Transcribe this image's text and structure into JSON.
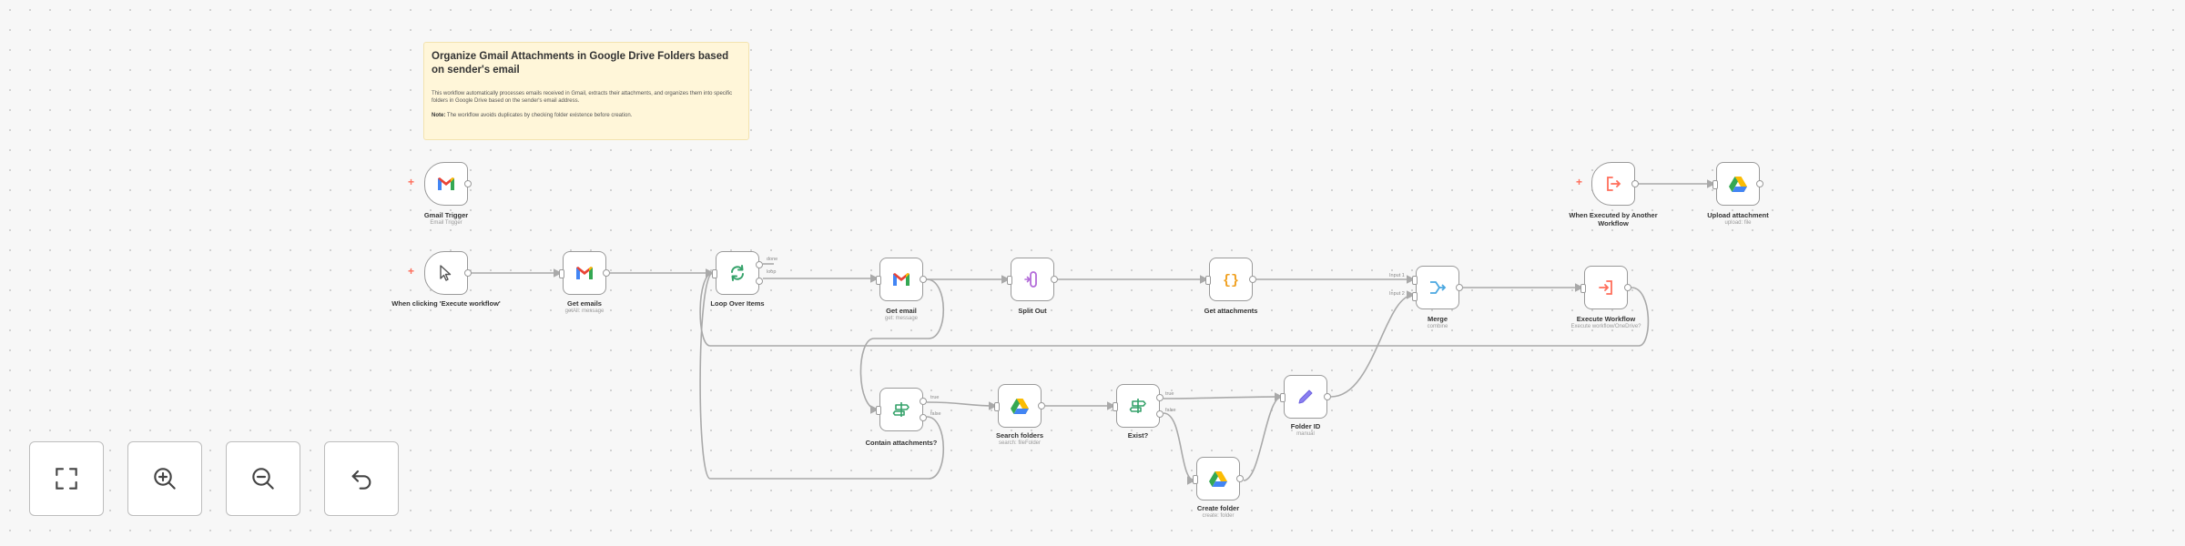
{
  "sticky": {
    "title": "Organize Gmail Attachments in Google Drive Folders based on sender's email",
    "body": "This workflow automatically processes emails received in Gmail, extracts their attachments, and organizes them into specific folders in Google Drive based on the sender's email address.",
    "note_label": "Note:",
    "note_text": "The workflow avoids duplicates by checking folder existence before creation."
  },
  "nodes": {
    "gmail_trigger": {
      "label": "Gmail Trigger",
      "sub": "Email Trigger",
      "icon": "gmail-icon"
    },
    "manual_trigger": {
      "label": "When clicking 'Execute workflow'",
      "icon": "cursor-icon"
    },
    "get_emails": {
      "label": "Get emails",
      "sub": "getAll: message",
      "icon": "gmail-icon"
    },
    "loop": {
      "label": "Loop Over Items",
      "icon": "loop-icon"
    },
    "get_email": {
      "label": "Get email",
      "sub": "get: message",
      "icon": "gmail-icon"
    },
    "split_out": {
      "label": "Split Out",
      "icon": "split-icon"
    },
    "get_attachments": {
      "label": "Get attachments",
      "icon": "code-icon"
    },
    "merge": {
      "label": "Merge",
      "sub": "combine",
      "icon": "merge-icon"
    },
    "execute_workflow": {
      "label": "Execute Workflow",
      "sub": "Execute workflow/OneDrive?",
      "icon": "execute-icon"
    },
    "workflow_trigger": {
      "label": "When Executed by Another Workflow",
      "icon": "workflow-trigger-icon"
    },
    "upload_attachment": {
      "label": "Upload attachment",
      "sub": "upload: file",
      "icon": "google-drive-icon"
    },
    "contain_attachments": {
      "label": "Contain attachments?",
      "icon": "if-icon"
    },
    "search_folders": {
      "label": "Search folders",
      "sub": "search: fileFolder",
      "icon": "google-drive-icon"
    },
    "exist": {
      "label": "Exist?",
      "icon": "if-icon"
    },
    "folder_id": {
      "label": "Folder ID",
      "sub": "manual",
      "icon": "pencil-icon"
    },
    "create_folder": {
      "label": "Create folder",
      "sub": "create: folder",
      "icon": "google-drive-icon"
    }
  },
  "small_labels": {
    "done": "done",
    "loop": "loop",
    "true": "true",
    "false": "false",
    "input1": "Input 1",
    "input2": "Input 2"
  },
  "controls": {
    "fit": "fit-view-icon",
    "zoom_in": "zoom-in-icon",
    "zoom_out": "zoom-out-icon",
    "reset": "reset-zoom-icon"
  }
}
